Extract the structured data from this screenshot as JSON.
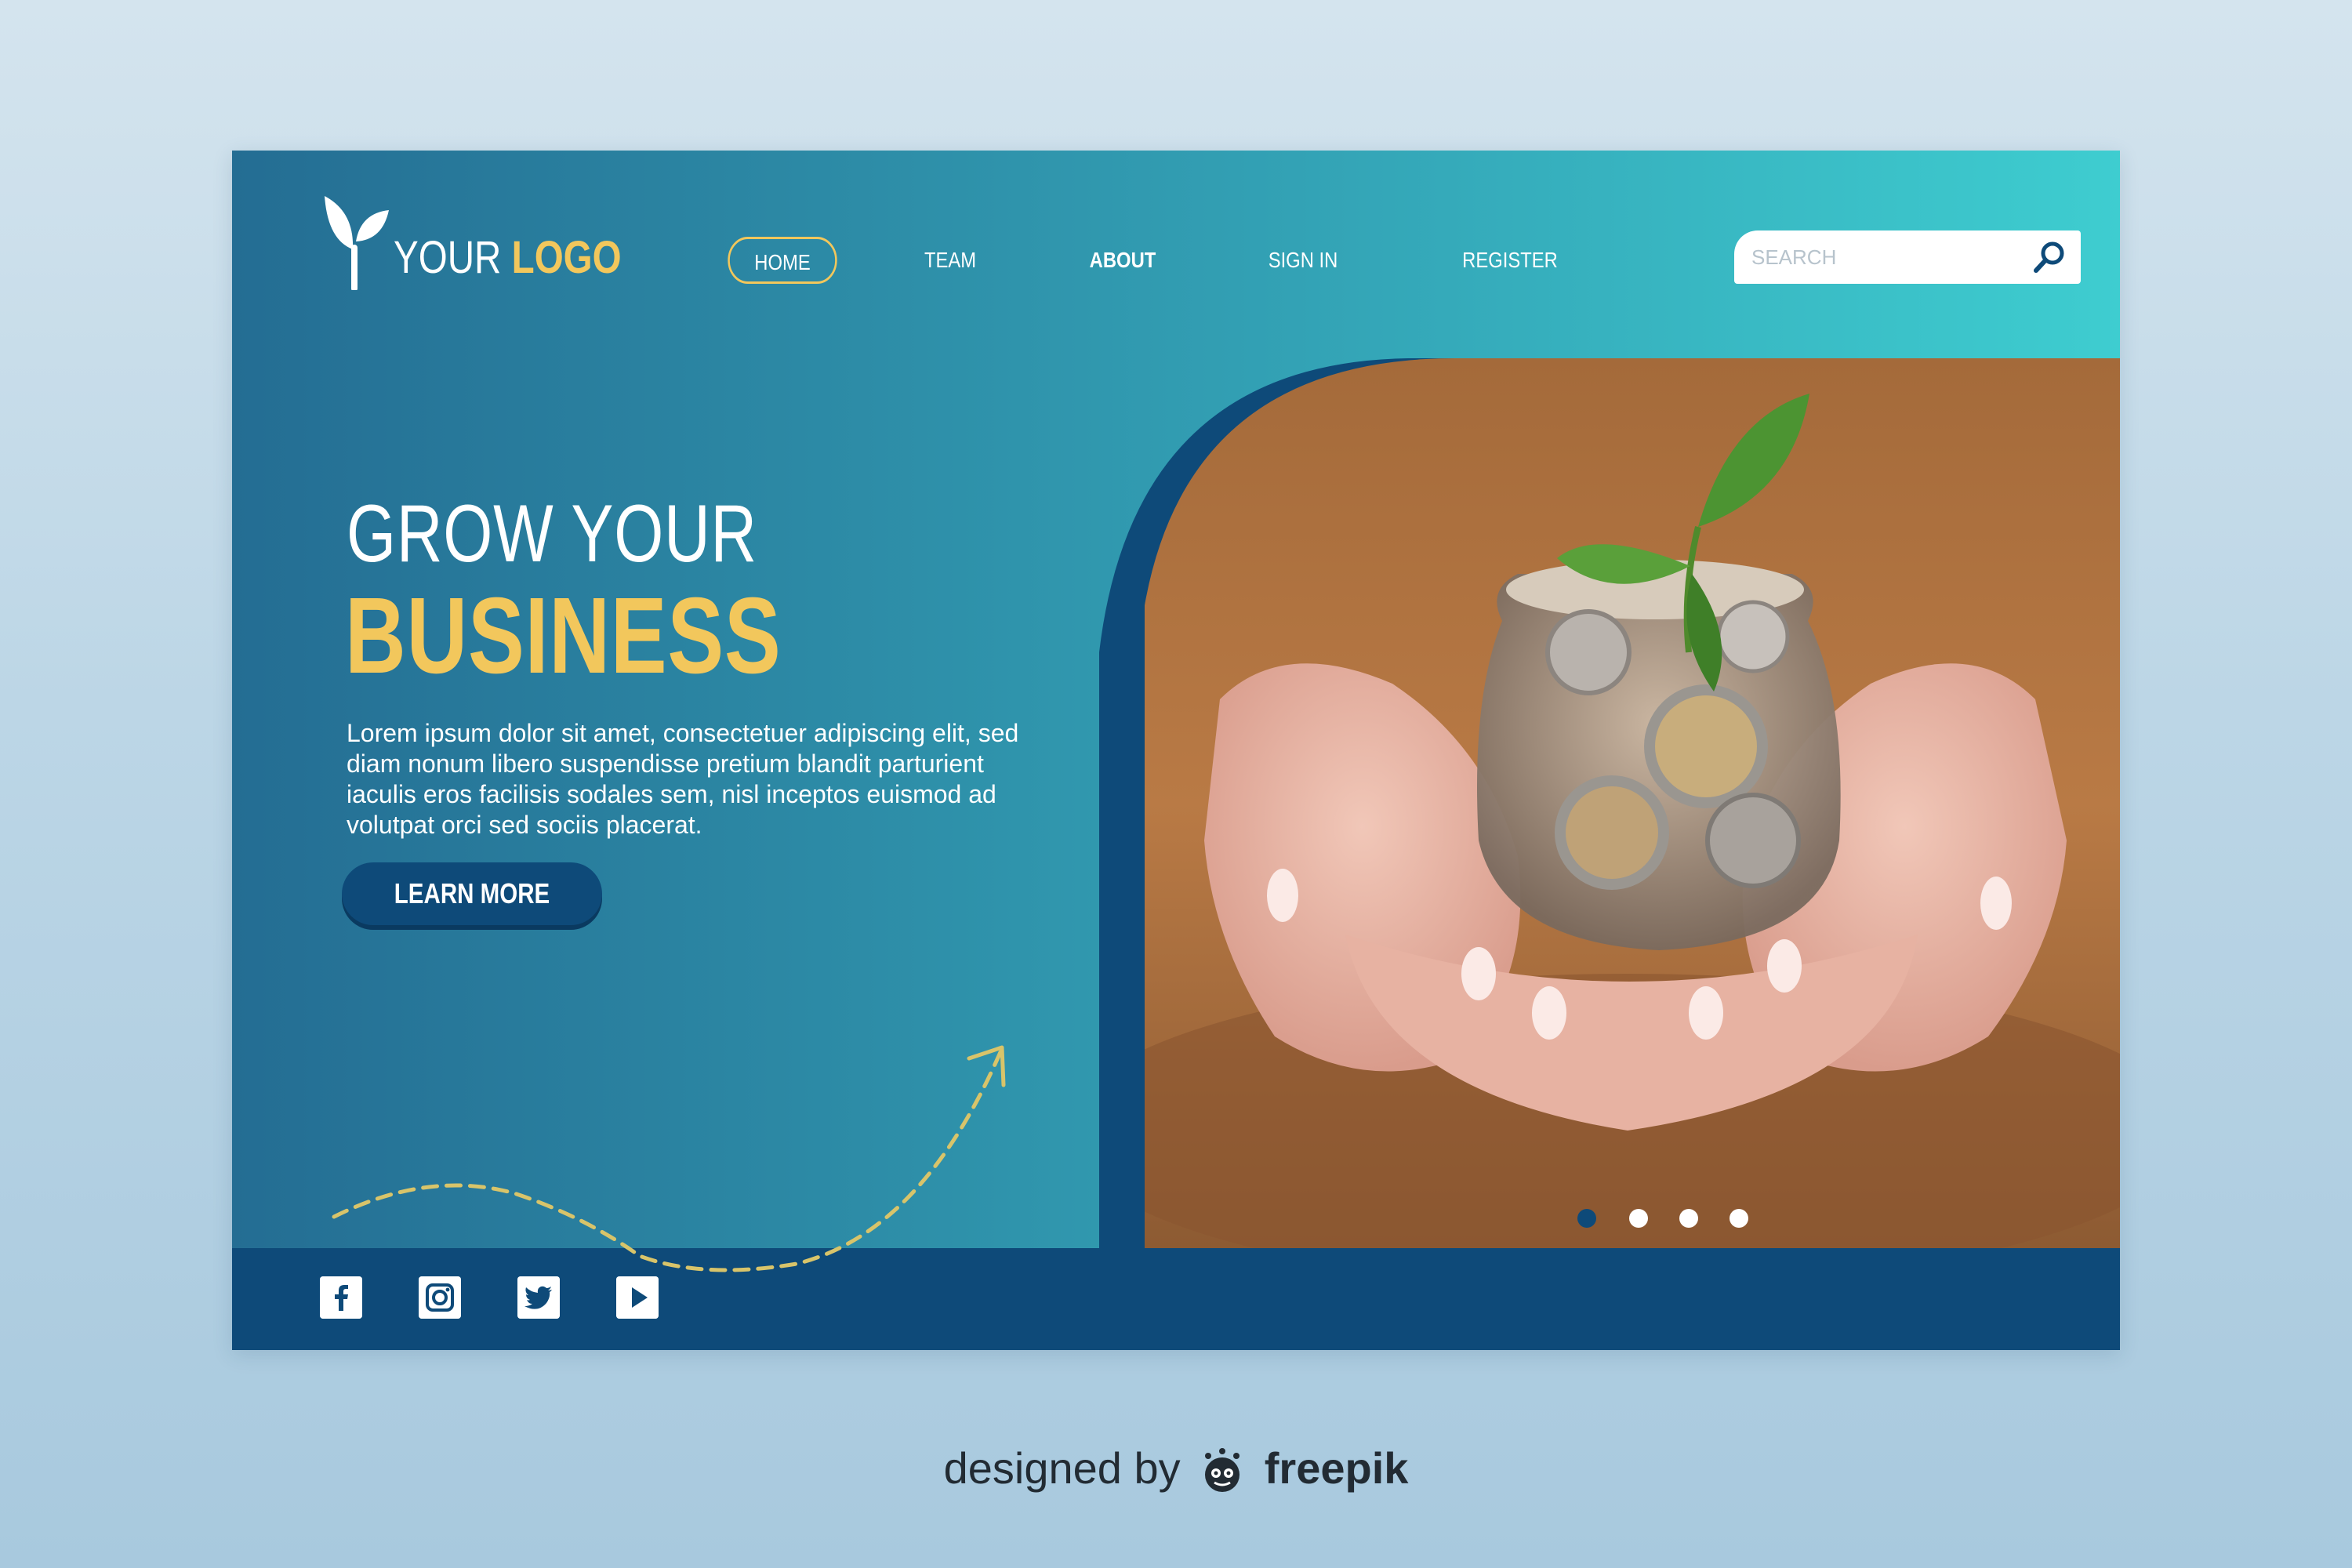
{
  "logo": {
    "text_plain": "YOUR",
    "text_bold": "LOGO"
  },
  "nav": {
    "items": [
      {
        "label": "HOME"
      },
      {
        "label": "TEAM"
      },
      {
        "label": "ABOUT"
      },
      {
        "label": "SIGN IN"
      },
      {
        "label": "REGISTER"
      }
    ]
  },
  "search": {
    "placeholder": "SEARCH",
    "value": "",
    "icon": "search-icon"
  },
  "hero": {
    "title_line1": "GROW YOUR",
    "title_line2": "BUSINESS",
    "body": "Lorem ipsum dolor sit amet, consectetuer adipiscing elit, sed diam nonum libero suspendisse pretium blandit parturient iaculis eros facilisis sodales sem, nisl inceptos euismod ad volutpat orci sed sociis placerat.",
    "cta_label": "LEARN MORE"
  },
  "slider": {
    "slide_count": 4,
    "active_index": 0
  },
  "social": [
    "facebook-icon",
    "instagram-icon",
    "twitter-icon",
    "youtube-icon"
  ],
  "credit": {
    "prefix": "designed by",
    "brand": "freepik"
  },
  "colors": {
    "accent_yellow": "#f2c75c",
    "navy": "#0e4a79",
    "teal_start": "#246d93",
    "teal_end": "#3ecdd0"
  }
}
